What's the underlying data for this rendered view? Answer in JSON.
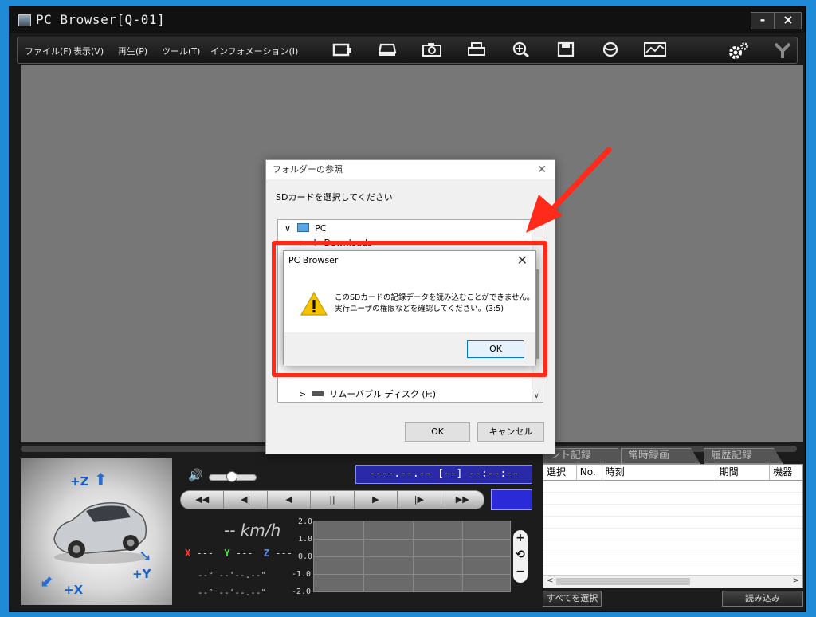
{
  "window": {
    "title": "PC Browser[Q-01]",
    "minimize": "-",
    "close": "×"
  },
  "menu": [
    {
      "label": "ファイル(F)"
    },
    {
      "label": "表示(V)"
    },
    {
      "label": "再生(P)"
    },
    {
      "label": "ツール(T)"
    },
    {
      "label": "インフォメーション(I)"
    }
  ],
  "toolbar_icons": [
    "sd-card-icon",
    "drive-icon",
    "camera-icon",
    "print-icon",
    "zoom-icon",
    "save-icon",
    "globe-icon",
    "graph-icon"
  ],
  "settings_icon": "gear-icon",
  "player": {
    "timecode": "----.--.-- [--] --:--:--",
    "speed_value": "--",
    "speed_unit": "km/h",
    "accel": {
      "x_label": "X",
      "x_value": "---",
      "y_label": "Y",
      "y_value": "---",
      "z_label": "Z",
      "z_value": "---"
    },
    "coord_lat": "--°  --'--.--\"",
    "coord_lon": "--°  --'--.--\"",
    "y_ticks": [
      "2.0",
      "1.0",
      "0.0",
      "-1.0",
      "-2.0"
    ],
    "axes": {
      "z": "+Z",
      "y": "+Y",
      "x": "+X"
    },
    "controls": [
      "◀◀",
      "◀|",
      "◀",
      "||",
      "▶",
      "|▶",
      "▶▶"
    ],
    "zoom": {
      "plus": "+",
      "reset": "⟲",
      "minus": "−"
    }
  },
  "tabs": [
    "ント記録",
    "常時録画",
    "履歴記録"
  ],
  "table": {
    "columns": [
      "選択",
      "No.",
      "時刻",
      "期間",
      "機器"
    ]
  },
  "bottom_buttons": {
    "select_all": "すべてを選択",
    "load": "読み込み"
  },
  "folder_dialog": {
    "title": "フォルダーの参照",
    "instruction": "SDカードを選択してください",
    "tree": [
      {
        "label": "PC",
        "expander": "∨"
      },
      {
        "label": "Downloads",
        "expander": ">"
      },
      {
        "label": "リムーバブル ディスク (F:)",
        "expander": ">"
      }
    ],
    "ok": "OK",
    "cancel": "キャンセル",
    "close": "✕"
  },
  "alert": {
    "title": "PC Browser",
    "line1": "このSDカードの記録データを読み込むことができません。",
    "line2": "実行ユーザの権限などを確認してください。(3:5)",
    "ok": "OK",
    "close": "✕"
  },
  "colors": {
    "annotation": "#ff2a1a",
    "timecode_bg": "#2a2aa8",
    "accent_blue": "#2a2ad8"
  }
}
